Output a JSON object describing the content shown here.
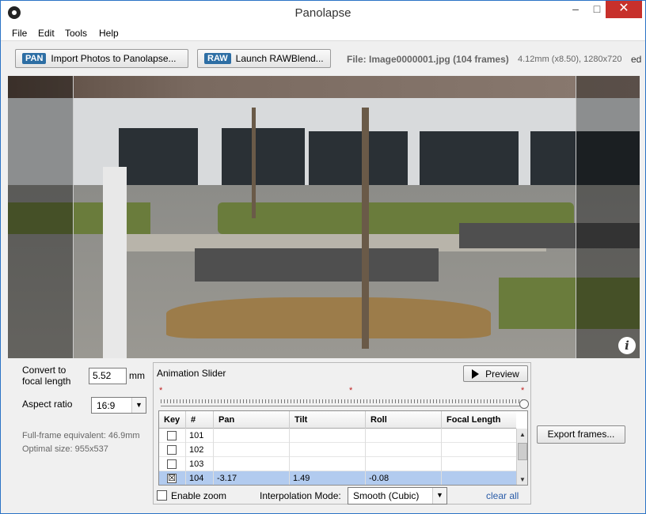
{
  "window": {
    "title": "Panolapse"
  },
  "titlebar": {
    "minimize": "‒",
    "maximize": "□",
    "close": "✕"
  },
  "menu": [
    "File",
    "Edit",
    "Tools",
    "Help"
  ],
  "toolbar": {
    "import_badge": "PAN",
    "import_label": "Import Photos to Panolapse...",
    "raw_badge": "RAW",
    "raw_label": "Launch RAWBlend...",
    "file_info": "File: Image0000001.jpg (104 frames)",
    "file_meta": "4.12mm (x8.50), 1280x720",
    "cut_text": "ed"
  },
  "left_panel": {
    "convert_label_1": "Convert to",
    "convert_label_2": "focal length",
    "focal_value": "5.52",
    "focal_unit": "mm",
    "aspect_label": "Aspect ratio",
    "aspect_value": "16:9",
    "full_frame": "Full-frame equivalent: 46.9mm",
    "optimal_size": "Optimal size: 955x537"
  },
  "animation": {
    "title": "Animation Slider",
    "preview_label": "Preview",
    "keyframe_marker": "*",
    "columns": [
      "Key",
      "#",
      "Pan",
      "Tilt",
      "Roll",
      "Focal Length"
    ],
    "rows": [
      {
        "key": "",
        "num": "101",
        "pan": "",
        "tilt": "",
        "roll": "",
        "focal": ""
      },
      {
        "key": "",
        "num": "102",
        "pan": "",
        "tilt": "",
        "roll": "",
        "focal": ""
      },
      {
        "key": "",
        "num": "103",
        "pan": "",
        "tilt": "",
        "roll": "",
        "focal": ""
      },
      {
        "key": "☒",
        "num": "104",
        "pan": "-3.17",
        "tilt": "1.49",
        "roll": "-0.08",
        "focal": ""
      }
    ],
    "enable_zoom": "Enable zoom",
    "interp_label": "Interpolation Mode:",
    "interp_value": "Smooth (Cubic)",
    "clear_all": "clear all"
  },
  "export_label": "Export frames...",
  "info_icon": "i"
}
